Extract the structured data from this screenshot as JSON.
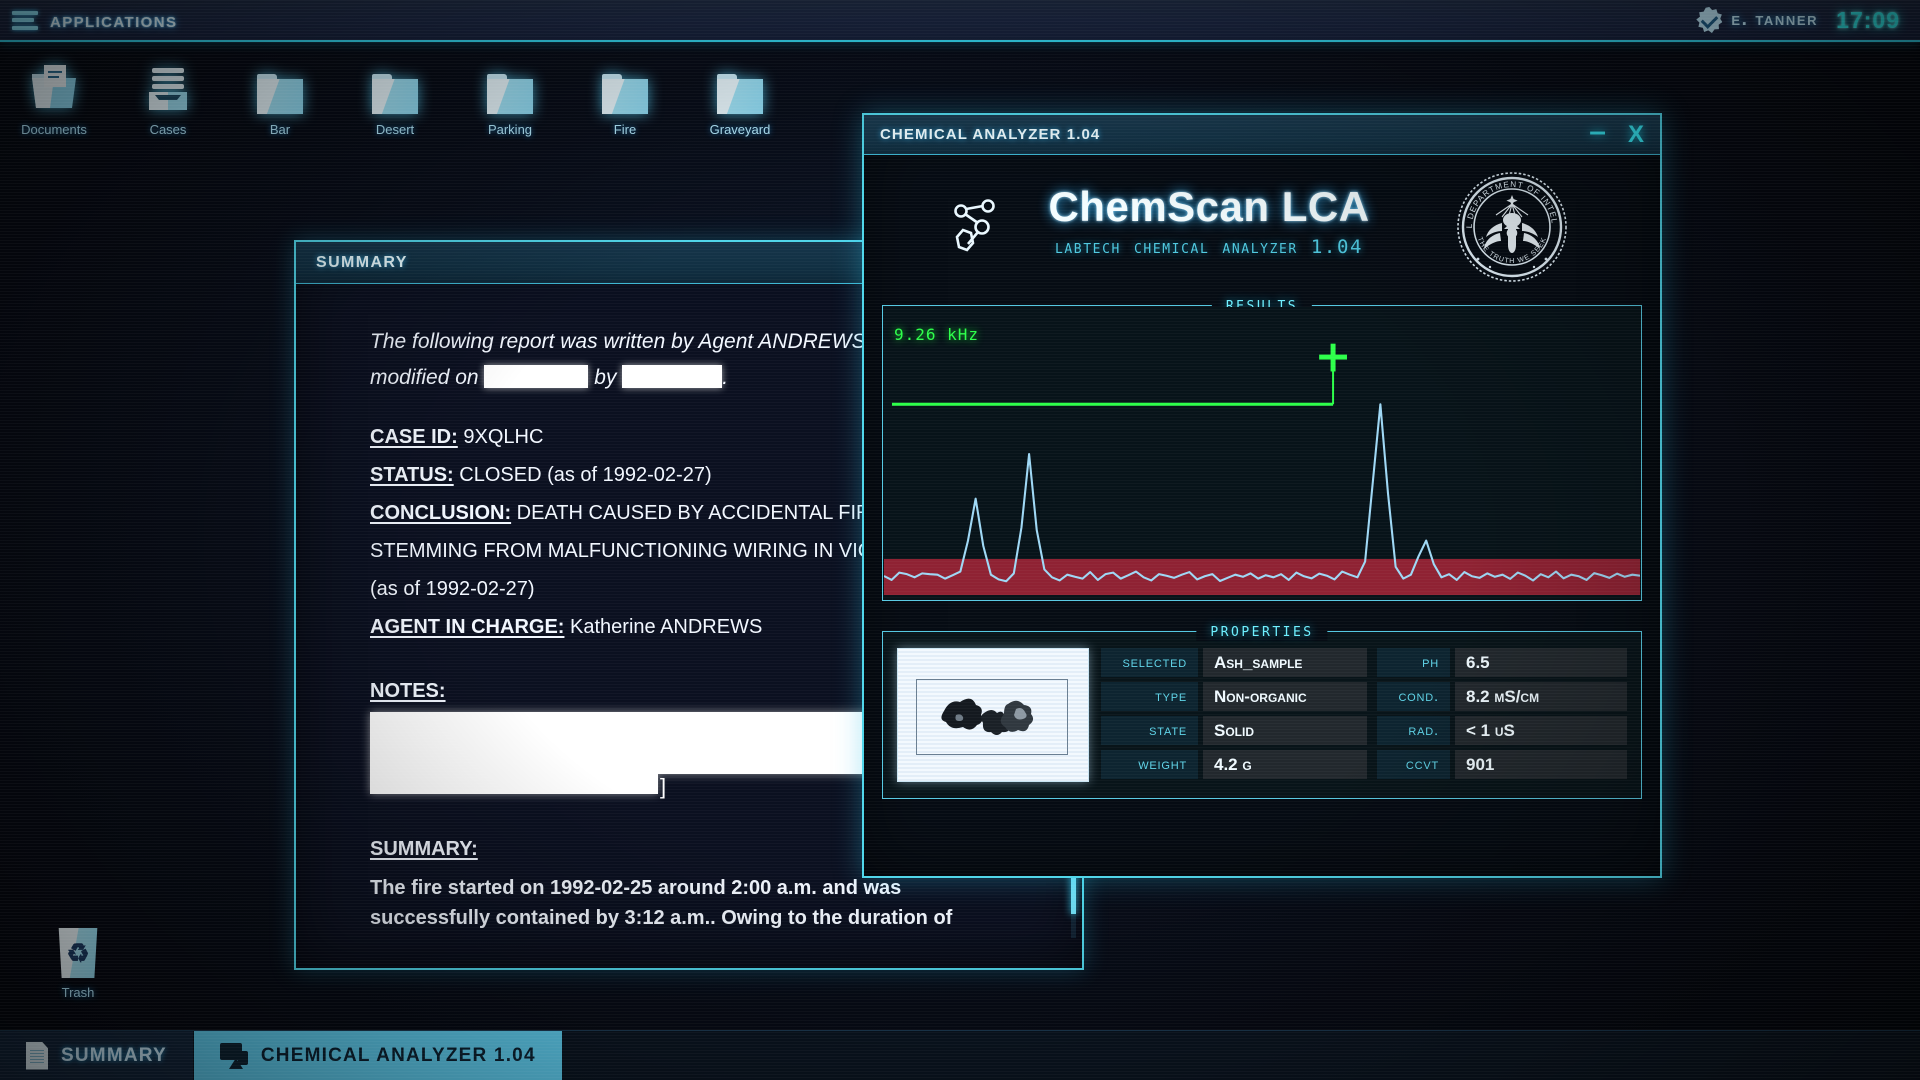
{
  "topbar": {
    "menu_icon": "hamburger-icon",
    "apps_label": "Applications",
    "user_name": "E. Tanner",
    "badge_icon": "verified-badge-icon",
    "clock": "17:09"
  },
  "desktop_icons": [
    {
      "label": "Documents",
      "icon": "documents-folder-icon"
    },
    {
      "label": "Cases",
      "icon": "cases-tray-icon"
    },
    {
      "label": "Bar",
      "icon": "folder-icon"
    },
    {
      "label": "Desert",
      "icon": "folder-icon"
    },
    {
      "label": "Parking",
      "icon": "folder-icon"
    },
    {
      "label": "Fire",
      "icon": "folder-icon"
    },
    {
      "label": "Graveyard",
      "icon": "folder-icon"
    }
  ],
  "trash": {
    "label": "Trash",
    "icon": "recycle-bin-icon"
  },
  "doc_window": {
    "title": "SUMMARY",
    "intro_prefix": "The following report was written by Agent ANDREWS",
    "intro_line2_a": "modified on",
    "intro_line2_b": "by",
    "intro_line2_c": ".",
    "fields": [
      {
        "label": "CASE ID:",
        "value": "9XQLHC"
      },
      {
        "label": "STATUS:",
        "value": "CLOSED (as of 1992-02-27)"
      }
    ],
    "conclusion_label": "CONCLUSION:",
    "conclusion_line1": "DEATH CAUSED BY ACCIDENTAL FIR",
    "conclusion_line2": "STEMMING FROM MALFUNCTIONING WIRING IN VICT",
    "conclusion_line3": "(as of 1992-02-27)",
    "agent_label": "AGENT IN CHARGE:",
    "agent_value": "Katherine ANDREWS",
    "notes_label": "NOTES:",
    "notes_bracket": "]",
    "summary_label": "SUMMARY:",
    "summary_line1": "The fire started on 1992-02-25 around 2:00 a.m. and was",
    "summary_line2": "successfully contained by 3:12 a.m.. Owing to the duration of"
  },
  "chem_window": {
    "title": "CHEMICAL ANALYZER 1.04",
    "minimize_label": "–",
    "close_label": "X",
    "brand_title": "ChemScan LCA",
    "brand_subtitle": "LabTech Chemical Analyzer 1.04",
    "molecule_icon": "molecule-icon",
    "seal": {
      "icon": "federal-seal-icon",
      "outer_text": "FEDERAL DEPARTMENT OF INTELLIGENCE",
      "motto": "THE TRUTH WE SEEK"
    },
    "results_panel_title": "Results",
    "properties_panel_title": "Properties",
    "sample_photo_alt": "ash-sample-photo",
    "properties_left": [
      {
        "key": "SELECTED",
        "value": "Ash_sample"
      },
      {
        "key": "TYPE",
        "value": "Non-organic"
      },
      {
        "key": "STATE",
        "value": "Solid"
      },
      {
        "key": "WEIGHT",
        "value": "4.2 g"
      }
    ],
    "properties_right": [
      {
        "key": "PH",
        "value": "6.5"
      },
      {
        "key": "COND.",
        "value": "8.2 mS/cm"
      },
      {
        "key": "RAD.",
        "value": "< 1 uS"
      },
      {
        "key": "CCVT",
        "value": "901"
      }
    ]
  },
  "chart_data": {
    "type": "line",
    "title": "Results",
    "xlabel": "",
    "ylabel": "",
    "threshold_label": "9.26 kHz",
    "threshold_value": 9.26,
    "threshold_unit": "kHz",
    "threshold_y_frac": 0.72,
    "marker": {
      "icon": "crosshair-marker",
      "x_frac": 0.594,
      "label": "selected-peak"
    },
    "noise_band": {
      "color": "#8f2233",
      "y_top_frac": 0.13,
      "y_bottom_frac": 0.0
    },
    "trace_color": "#9fd8f5",
    "threshold_color": "#2dff4a",
    "grid": false,
    "peaks": [
      {
        "x_frac": 0.104,
        "height_frac": 0.36
      },
      {
        "x_frac": 0.163,
        "height_frac": 0.53
      },
      {
        "x_frac": 0.594,
        "height_frac": 0.72
      },
      {
        "x_frac": 0.7,
        "height_frac": 0.2
      }
    ],
    "baseline_frac": 0.068,
    "noise_amplitude_frac": 0.035,
    "series": [
      {
        "name": "spectrum",
        "values": [
          0.065,
          0.05,
          0.078,
          0.072,
          0.06,
          0.075,
          0.072,
          0.07,
          0.055,
          0.068,
          0.082,
          0.2,
          0.36,
          0.18,
          0.07,
          0.052,
          0.045,
          0.075,
          0.25,
          0.53,
          0.24,
          0.09,
          0.06,
          0.048,
          0.07,
          0.062,
          0.055,
          0.08,
          0.05,
          0.072,
          0.078,
          0.055,
          0.068,
          0.082,
          0.06,
          0.048,
          0.072,
          0.066,
          0.058,
          0.07,
          0.08,
          0.052,
          0.064,
          0.072,
          0.046,
          0.058,
          0.07,
          0.062,
          0.075,
          0.055,
          0.068,
          0.06,
          0.072,
          0.05,
          0.078,
          0.064,
          0.056,
          0.074,
          0.066,
          0.052,
          0.082,
          0.07,
          0.06,
          0.12,
          0.42,
          0.72,
          0.38,
          0.1,
          0.055,
          0.07,
          0.14,
          0.2,
          0.11,
          0.06,
          0.072,
          0.05,
          0.08,
          0.064,
          0.058,
          0.075,
          0.062,
          0.07,
          0.054,
          0.078,
          0.066,
          0.048,
          0.072,
          0.06,
          0.082,
          0.056,
          0.07,
          0.064,
          0.05,
          0.076,
          0.068,
          0.058,
          0.074,
          0.062,
          0.07,
          0.066
        ]
      }
    ]
  },
  "taskbar": [
    {
      "label": "SUMMARY",
      "icon": "document-icon",
      "active": false
    },
    {
      "label": "CHEMICAL ANALYZER 1.04",
      "icon": "analyzer-icon",
      "active": true
    }
  ]
}
